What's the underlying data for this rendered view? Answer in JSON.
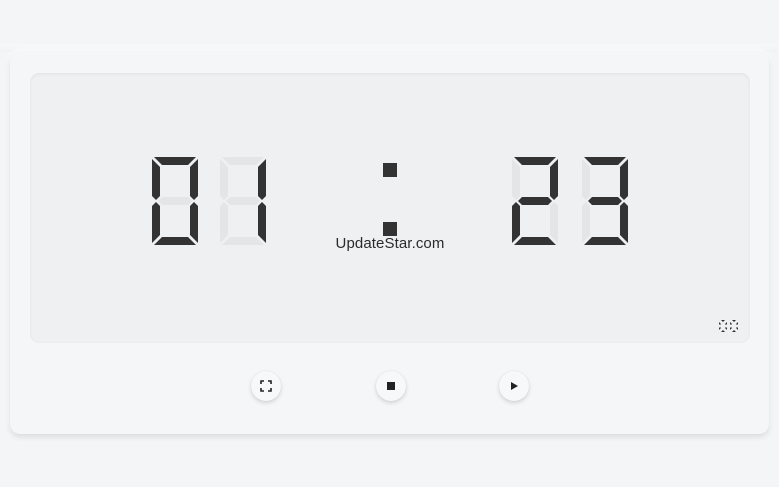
{
  "timer": {
    "minutes": "01",
    "seconds": "23",
    "separator": ":",
    "hundredths": "00"
  },
  "watermark": "UpdateStar.com",
  "controls": [
    {
      "name": "fullscreen-button",
      "icon": "fullscreen-icon"
    },
    {
      "name": "stop-button",
      "icon": "stop-icon"
    },
    {
      "name": "play-button",
      "icon": "play-icon"
    }
  ],
  "colors": {
    "digit_on": "#333333",
    "digit_off": "#e4e5e6",
    "background": "#f4f5f6",
    "screen": "#eff0f1"
  }
}
